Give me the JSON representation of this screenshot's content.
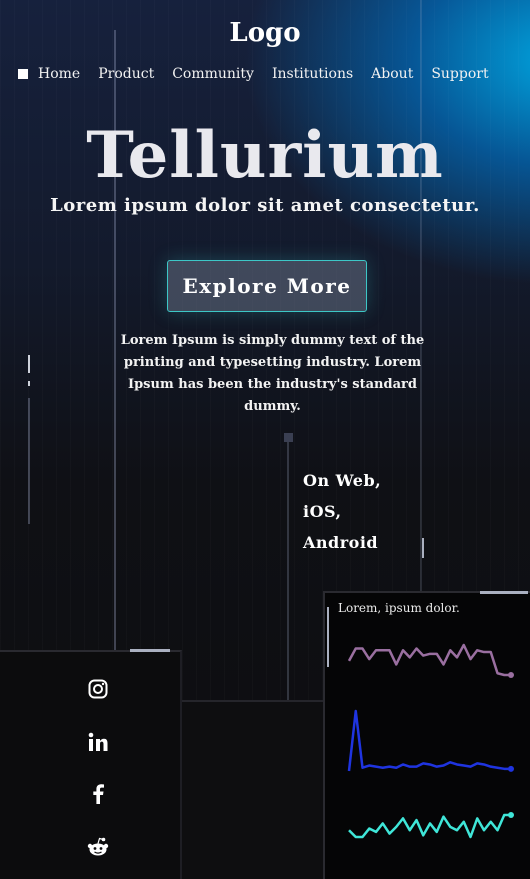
{
  "header": {
    "logo": "Logo"
  },
  "nav": {
    "items": [
      {
        "label": "Home"
      },
      {
        "label": "Product"
      },
      {
        "label": "Community"
      },
      {
        "label": "Institutions"
      },
      {
        "label": "About"
      },
      {
        "label": "Support"
      }
    ]
  },
  "hero": {
    "title": "Tellurium",
    "subtitle": "Lorem ipsum dolor sit amet consectetur.",
    "cta_label": "Explore More",
    "description": "Lorem Ipsum is simply dummy text of the printing and typesetting industry. Lorem Ipsum has been the industry's standard dummy."
  },
  "platforms": [
    "On Web,",
    "iOS,",
    "Android"
  ],
  "social": [
    "instagram-icon",
    "linkedin-icon",
    "facebook-icon",
    "reddit-icon"
  ],
  "colors": {
    "accent_cyan": "#3dc7c7",
    "series_purple": "#9a6fa0",
    "series_blue": "#1f34e0",
    "series_teal": "#3fe6d8"
  },
  "chart_panel": {
    "title": "Lorem, ipsum dolor."
  },
  "chart_data": {
    "type": "line",
    "title": "Lorem, ipsum dolor.",
    "x": [
      0,
      1,
      2,
      3,
      4,
      5,
      6,
      7,
      8,
      9,
      10,
      11,
      12,
      13,
      14,
      15,
      16,
      17,
      18,
      19,
      20,
      21,
      22,
      23,
      24
    ],
    "series": [
      {
        "color": "#9a6fa0",
        "values": [
          8,
          15,
          15,
          9,
          14,
          14,
          14,
          6,
          14,
          10,
          15,
          11,
          12,
          12,
          6,
          14,
          10,
          17,
          9,
          14,
          13,
          13,
          1,
          0,
          0
        ],
        "points": 25
      },
      {
        "color": "#1f34e0",
        "values": [
          5,
          60,
          8,
          10,
          9,
          8,
          9,
          8,
          11,
          9,
          9,
          12,
          11,
          9,
          10,
          13,
          11,
          10,
          9,
          12,
          11,
          9,
          8,
          7,
          7
        ],
        "points": 25
      },
      {
        "color": "#3fe6d8",
        "values": [
          6,
          2,
          2,
          7,
          5,
          10,
          4,
          8,
          13,
          6,
          12,
          3,
          10,
          5,
          14,
          8,
          6,
          11,
          2,
          13,
          6,
          11,
          6,
          15,
          15
        ],
        "points": 25
      }
    ]
  }
}
